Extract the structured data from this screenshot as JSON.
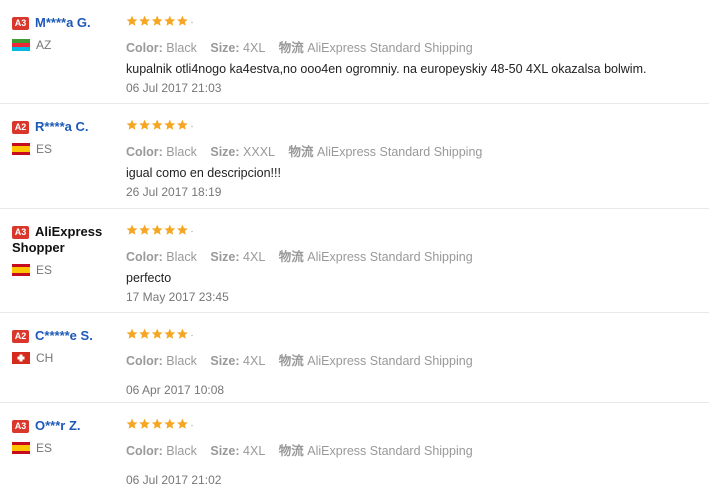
{
  "reviews": [
    {
      "level_badge": "A3",
      "name": "M****a G.",
      "name_color": "#1e59b8",
      "country_code": "AZ",
      "flag": "az",
      "stars_filled": 5,
      "color_label": "Color:",
      "color_value": "Black",
      "size_label": "Size:",
      "size_value": "4XL",
      "shipping_label": "物流",
      "shipping_value": "AliExpress Standard Shipping",
      "text": "kupalnik otli4nogo ka4estva,no ooo4en ogromniy. na europeyskiy 48-50 4XL okazalsa bolwim.",
      "date": "06 Jul 2017 21:03"
    },
    {
      "level_badge": "A2",
      "name": "R****a C.",
      "name_color": "#1e59b8",
      "country_code": "ES",
      "flag": "es",
      "stars_filled": 5,
      "color_label": "Color:",
      "color_value": "Black",
      "size_label": "Size:",
      "size_value": "XXXL",
      "shipping_label": "物流",
      "shipping_value": "AliExpress Standard Shipping",
      "text": "igual como en descripcion!!!",
      "date": "26 Jul 2017 18:19"
    },
    {
      "level_badge": "A3",
      "name": "AliExpress Shopper",
      "name_color": "#111111",
      "country_code": "ES",
      "flag": "es",
      "stars_filled": 5,
      "color_label": "Color:",
      "color_value": "Black",
      "size_label": "Size:",
      "size_value": "4XL",
      "shipping_label": "物流",
      "shipping_value": "AliExpress Standard Shipping",
      "text": "perfecto",
      "date": "17 May 2017 23:45"
    },
    {
      "level_badge": "A2",
      "name": "C*****e S.",
      "name_color": "#1e59b8",
      "country_code": "CH",
      "flag": "ch",
      "stars_filled": 5,
      "color_label": "Color:",
      "color_value": "Black",
      "size_label": "Size:",
      "size_value": "4XL",
      "shipping_label": "物流",
      "shipping_value": "AliExpress Standard Shipping",
      "text": "",
      "date": "06 Apr 2017 10:08"
    },
    {
      "level_badge": "A3",
      "name": "O***r Z.",
      "name_color": "#1e59b8",
      "country_code": "ES",
      "flag": "es",
      "stars_filled": 5,
      "color_label": "Color:",
      "color_value": "Black",
      "size_label": "Size:",
      "size_value": "4XL",
      "shipping_label": "物流",
      "shipping_value": "AliExpress Standard Shipping",
      "text": "",
      "date": "06 Jul 2017 21:02"
    }
  ],
  "colors": {
    "star": "#f5a623",
    "badge": "#d9362c",
    "username": "#1e59b8"
  }
}
